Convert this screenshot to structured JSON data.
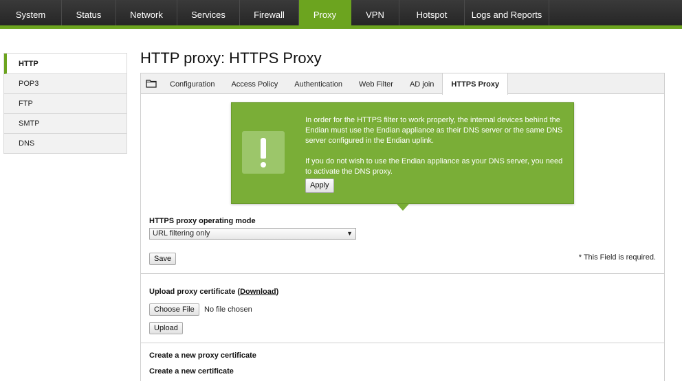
{
  "topnav": {
    "items": [
      {
        "label": "System",
        "active": false
      },
      {
        "label": "Status",
        "active": false
      },
      {
        "label": "Network",
        "active": false
      },
      {
        "label": "Services",
        "active": false
      },
      {
        "label": "Firewall",
        "active": false
      },
      {
        "label": "Proxy",
        "active": true
      },
      {
        "label": "VPN",
        "active": false
      },
      {
        "label": "Hotspot",
        "active": false
      },
      {
        "label": "Logs and Reports",
        "active": false
      }
    ]
  },
  "sidebar": {
    "items": [
      {
        "label": "HTTP",
        "active": true
      },
      {
        "label": "POP3",
        "active": false
      },
      {
        "label": "FTP",
        "active": false
      },
      {
        "label": "SMTP",
        "active": false
      },
      {
        "label": "DNS",
        "active": false
      }
    ]
  },
  "page": {
    "title": "HTTP proxy: HTTPS Proxy"
  },
  "tabs": [
    {
      "label": "Configuration",
      "active": false
    },
    {
      "label": "Access Policy",
      "active": false
    },
    {
      "label": "Authentication",
      "active": false
    },
    {
      "label": "Web Filter",
      "active": false
    },
    {
      "label": "AD join",
      "active": false
    },
    {
      "label": "HTTPS Proxy",
      "active": true
    }
  ],
  "notice": {
    "paragraph1": "In order for the HTTPS filter to work properly, the internal devices behind the Endian must use the Endian appliance as their DNS server or the same DNS server configured in the Endian uplink.",
    "paragraph2": "If you do not wish to use the Endian appliance as your DNS server, you need to activate the DNS proxy.",
    "apply_label": "Apply",
    "color": "#7aae37"
  },
  "mode": {
    "label": "HTTPS proxy operating mode",
    "selected": "URL filtering only",
    "save_label": "Save",
    "required_note": "* This Field is required."
  },
  "upload": {
    "label": "Upload proxy certificate",
    "open_paren": "(",
    "download_label": "Download",
    "close_paren": ")",
    "choose_label": "Choose File",
    "file_status": "No file chosen",
    "upload_label": "Upload"
  },
  "create": {
    "heading": "Create a new proxy certificate",
    "subheading": "Create a new certificate"
  },
  "theme": {
    "accent": "#6ca41f",
    "nav_bg": "#2e2e2e"
  }
}
